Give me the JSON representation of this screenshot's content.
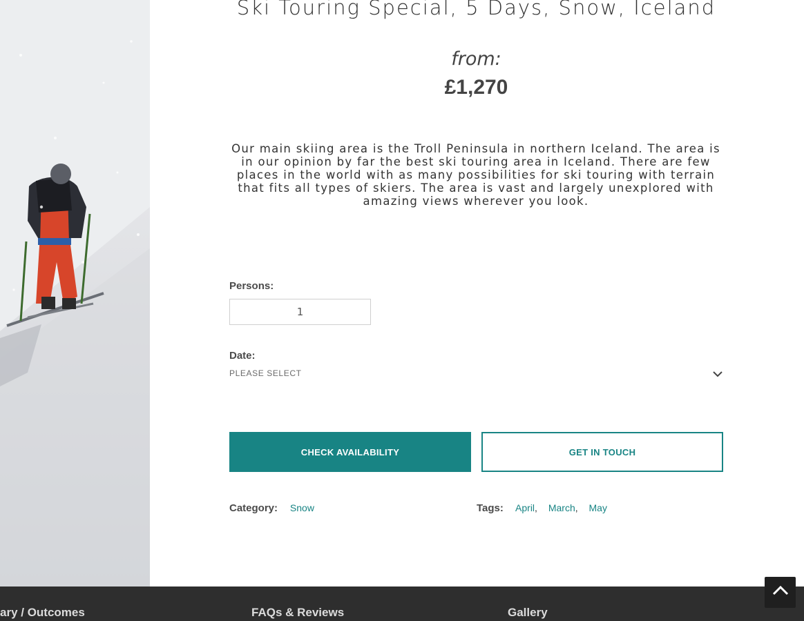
{
  "product": {
    "title": "Ski Touring Special, 5 Days, Snow, Iceland",
    "from_label": "from:",
    "price": "£1,270",
    "description": "Our main skiing area is the Troll Peninsula in northern Iceland. The area is in our opinion by far the best ski touring area in Iceland. There are few places in the world with as many possibilities for ski touring with terrain that fits all types of skiers. The area is vast and largely unexplored with amazing views wherever you look."
  },
  "booking": {
    "persons_label": "Persons:",
    "persons_value": "1",
    "date_label": "Date:",
    "date_placeholder": "PLEASE SELECT",
    "check_availability": "CHECK AVAILABILITY",
    "get_in_touch": "GET IN TOUCH"
  },
  "meta": {
    "category_label": "Category:",
    "category": "Snow",
    "tags_label": "Tags:",
    "tags": [
      "April",
      "March",
      "May"
    ]
  },
  "footer": {
    "links": [
      "ary / Outcomes",
      "FAQs & Reviews",
      "Gallery"
    ]
  },
  "icons": {
    "date_dropdown": "chevron-down-icon",
    "back_to_top": "chevron-up-icon"
  },
  "colors": {
    "accent": "#188484",
    "footer_bg": "#2e2e2e"
  }
}
